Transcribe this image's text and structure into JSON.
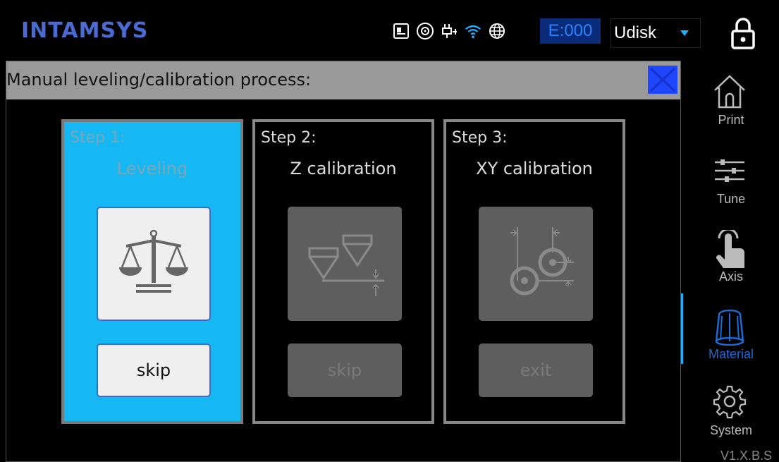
{
  "header": {
    "logo": "INTAMSYS",
    "counter": "E:000",
    "storage_select": {
      "value": "Udisk"
    },
    "status_icons": [
      "printer-status-icon",
      "camera-icon",
      "usb-plug-icon",
      "wifi-icon",
      "globe-icon"
    ],
    "lock_icon": "lock-icon"
  },
  "dialog": {
    "title": "Manual leveling/calibration process:",
    "close_icon": "close-icon",
    "steps": [
      {
        "label": "Step 1:",
        "name": "Leveling",
        "icon": "balance-scale-icon",
        "button": "skip",
        "enabled": true
      },
      {
        "label": "Step 2:",
        "name": "Z calibration",
        "icon": "z-calibration-icon",
        "button": "skip",
        "enabled": false
      },
      {
        "label": "Step 3:",
        "name": "XY calibration",
        "icon": "xy-calibration-icon",
        "button": "exit",
        "enabled": false
      }
    ]
  },
  "sidebar": {
    "items": [
      {
        "label": "Print",
        "icon": "home-icon"
      },
      {
        "label": "Tune",
        "icon": "sliders-icon"
      },
      {
        "label": "Axis",
        "icon": "hand-pointer-icon"
      },
      {
        "label": "Material",
        "icon": "material-spool-icon",
        "active": true
      },
      {
        "label": "System",
        "icon": "gear-icon"
      }
    ],
    "version": "V1.X.B.S"
  },
  "colors": {
    "accent": "#16b8f3",
    "active_nav": "#1a6bd8",
    "counter_bg": "#0a2a7a",
    "close_button": "#1e46ff"
  }
}
